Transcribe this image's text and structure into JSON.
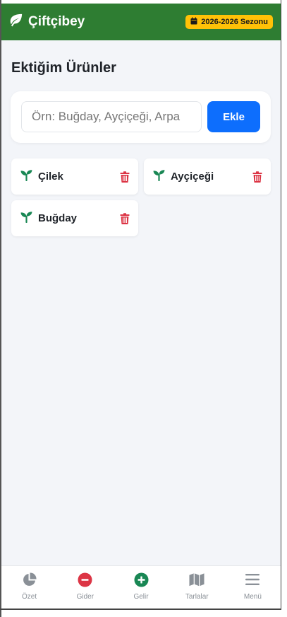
{
  "header": {
    "brand": "Çiftçibey",
    "season": "2026-2026 Sezonu"
  },
  "page": {
    "title": "Ektiğim Ürünler"
  },
  "add_form": {
    "placeholder": "Örn: Buğday, Ayçiçeği, Arpa",
    "value": "",
    "button_label": "Ekle"
  },
  "crops": [
    {
      "name": "Çilek"
    },
    {
      "name": "Ayçiçeği"
    },
    {
      "name": "Buğday"
    }
  ],
  "bottom_nav": [
    {
      "label": "Özet",
      "icon": "pie-chart-icon"
    },
    {
      "label": "Gider",
      "icon": "minus-circle-icon"
    },
    {
      "label": "Gelir",
      "icon": "plus-circle-icon"
    },
    {
      "label": "Tarlalar",
      "icon": "map-icon"
    },
    {
      "label": "Menü",
      "icon": "menu-icon"
    }
  ],
  "colors": {
    "header": "#2e7d32",
    "badge": "#ffc107",
    "primary": "#0d6efd",
    "delete": "#dc3545",
    "gider": "#dc3545",
    "gelir": "#198754",
    "sprout": "#198754"
  }
}
